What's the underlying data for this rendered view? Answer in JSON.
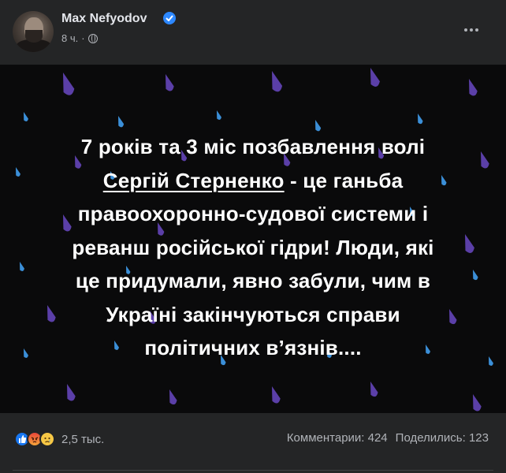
{
  "post": {
    "author": "Max Nefyodov",
    "time": "8 ч.",
    "separator": "·",
    "image_text": {
      "line1": "7 років та 3 міс позбавлення волі",
      "link_name": "Сергій Стерненко",
      "line2_rest": " - це ганьба",
      "line3": "правоохоронно-судової системи і",
      "line4": "реванш російської гідри! Люди, які",
      "line5": "це придумали, явно забули, чим в",
      "line6": "Україні закінчуються справи",
      "line7": "політичних в’язнів...."
    }
  },
  "footer": {
    "reaction_count": "2,5 тыс.",
    "comments": "Комментарии: 424",
    "shares": "Поделились: 123"
  },
  "icons": {
    "verified": "verified-badge-icon",
    "audience": "globe-icon",
    "more": "more-dots-icon",
    "reactions": [
      "like-icon",
      "angry-icon",
      "sad-icon"
    ]
  },
  "colors": {
    "background": "#242526",
    "image_background": "#0a0a0b",
    "drop_purple": "#5b3fa8",
    "drop_blue": "#3b8fd8",
    "verified": "#2d88ff",
    "secondary_text": "#b0b3b8"
  }
}
